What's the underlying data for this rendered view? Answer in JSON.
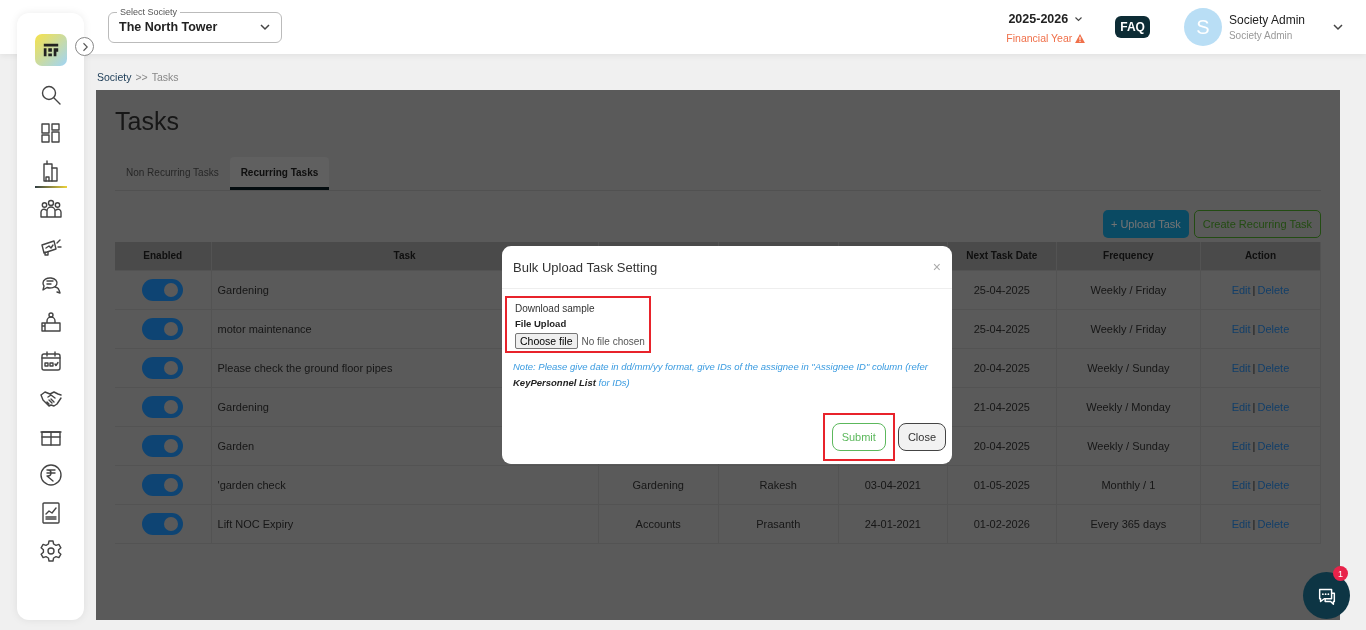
{
  "header": {
    "society_select": {
      "label": "Select Society",
      "value": "The North Tower"
    },
    "financial_year": {
      "value": "2025-2026",
      "caption": "Financial Year",
      "warning": true
    },
    "faq": "FAQ",
    "user": {
      "initial": "S",
      "name": "Society Admin",
      "role": "Society Admin"
    }
  },
  "sidebar": {
    "items": [
      {
        "kind": "search",
        "selected": false
      },
      {
        "kind": "dashboard",
        "selected": false
      },
      {
        "kind": "building",
        "selected": true
      },
      {
        "kind": "people",
        "selected": false
      },
      {
        "kind": "megaphone",
        "selected": false
      },
      {
        "kind": "chat",
        "selected": false
      },
      {
        "kind": "desk",
        "selected": false
      },
      {
        "kind": "calendar",
        "selected": false
      },
      {
        "kind": "handshake",
        "selected": false
      },
      {
        "kind": "box",
        "selected": false
      },
      {
        "kind": "rupee",
        "selected": false
      },
      {
        "kind": "report",
        "selected": false
      },
      {
        "kind": "settings",
        "selected": false
      }
    ]
  },
  "breadcrumb": {
    "items": [
      "Society",
      "Tasks"
    ],
    "separator": ">>"
  },
  "page": {
    "title": "Tasks",
    "tabs": [
      {
        "label": "Non Recurring Tasks",
        "selected": false
      },
      {
        "label": "Recurring Tasks",
        "selected": true
      }
    ],
    "actions": [
      {
        "label": "+ Upload Task",
        "kind": "primary"
      },
      {
        "label": "Create Recurring Task",
        "kind": "outline"
      }
    ],
    "table": {
      "columns": [
        {
          "label": "Enabled"
        },
        {
          "label": "Task"
        },
        {},
        {},
        {},
        {
          "label": "Next Task Date"
        },
        {
          "label": "Frequency"
        },
        {
          "label": "Action"
        }
      ],
      "rows": [
        {
          "enabled": true,
          "task": "Gardening",
          "next_task_date": "25-04-2025",
          "frequency": "Weekly / Friday",
          "action": {
            "links": [
              "Edit",
              "Delete"
            ],
            "separator": "|"
          }
        },
        {
          "enabled": true,
          "task": "motor maintenance",
          "next_task_date": "25-04-2025",
          "frequency": "Weekly / Friday",
          "action": {
            "links": [
              "Edit",
              "Delete"
            ],
            "separator": "|"
          }
        },
        {
          "enabled": true,
          "task": "Please check the ground floor pipes",
          "next_task_date": "20-04-2025",
          "frequency": "Weekly / Sunday",
          "action": {
            "links": [
              "Edit",
              "Delete"
            ],
            "separator": "|"
          }
        },
        {
          "enabled": true,
          "task": "Gardening",
          "next_task_date": "21-04-2025",
          "frequency": "Weekly / Monday",
          "action": {
            "links": [
              "Edit",
              "Delete"
            ],
            "separator": "|"
          }
        },
        {
          "enabled": true,
          "task": "Garden",
          "next_task_date": "20-04-2025",
          "frequency": "Weekly / Sunday",
          "action": {
            "links": [
              "Edit",
              "Delete"
            ],
            "separator": "|"
          }
        },
        {
          "enabled": true,
          "task": "'garden check",
          "column_3": "Gardening",
          "column_4": "Rakesh",
          "column_5": "03-04-2021",
          "next_task_date": "01-05-2025",
          "frequency": "Monthly / 1",
          "action": {
            "links": [
              "Edit",
              "Delete"
            ],
            "separator": "|"
          }
        },
        {
          "enabled": true,
          "task": "Lift NOC Expiry",
          "column_3": "Accounts",
          "column_4": "Prasanth",
          "column_5": "24-01-2021",
          "next_task_date": "01-02-2026",
          "frequency": "Every 365 days",
          "action": {
            "links": [
              "Edit",
              "Delete"
            ],
            "separator": "|"
          }
        }
      ]
    }
  },
  "modal": {
    "title": "Bulk Upload Task Setting",
    "close": "×",
    "upload": {
      "highlighted": true,
      "download_link": "Download sample",
      "label": "File Upload",
      "button": "Choose file",
      "status": "No file chosen"
    },
    "note": "Note: Please give date in dd/mm/yy format, give IDs of the assignee in \"Assignee ID\" column (refer **KeyPersonnel List** for IDs)",
    "buttons": [
      {
        "label": "Submit",
        "kind": "submit",
        "highlighted": true
      },
      {
        "label": "Close",
        "kind": "close",
        "highlighted": false
      }
    ]
  },
  "chat_button": {
    "badge": "1"
  }
}
